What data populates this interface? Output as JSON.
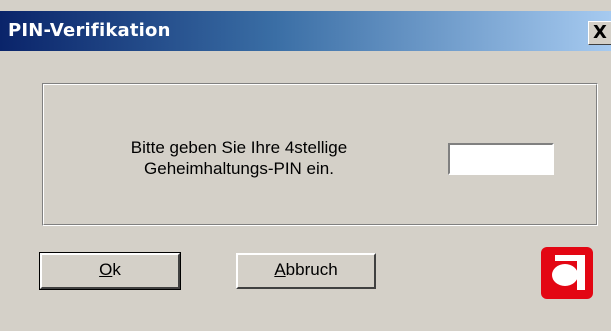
{
  "window": {
    "title": "PIN-Verifikation",
    "close_glyph": "X"
  },
  "prompt": {
    "line1": "Bitte geben Sie Ihre 4stellige",
    "line2": "Geheimhaltungs-PIN ein."
  },
  "pin_field": {
    "value": "",
    "placeholder": ""
  },
  "buttons": {
    "ok_label": "Ok",
    "ok_mnemonic": "O",
    "ok_rest": "k",
    "cancel_label": "Abbruch",
    "cancel_mnemonic": "A",
    "cancel_rest": "bbruch"
  },
  "logo": {
    "icon": "company-logo-icon",
    "color": "#e30613"
  },
  "colors": {
    "dialog_bg": "#d4d0c8",
    "title_start": "#0a246a",
    "title_end": "#a6caf0"
  }
}
